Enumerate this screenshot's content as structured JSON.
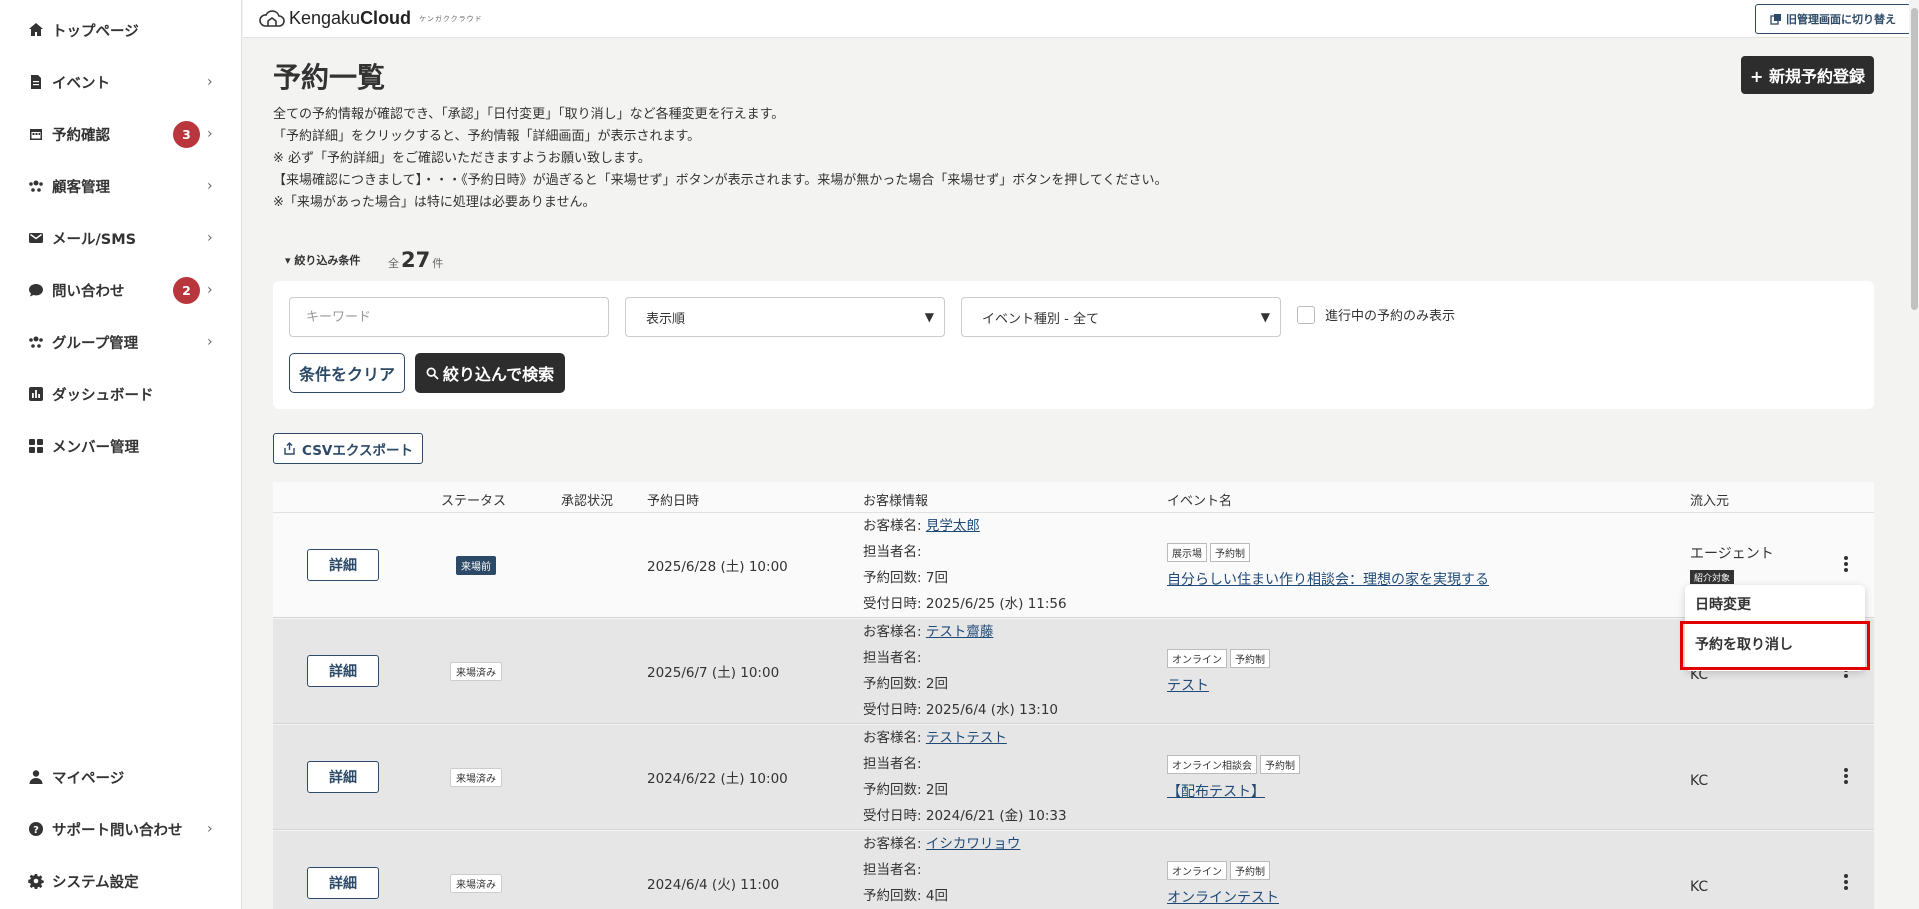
{
  "sidebar": {
    "items": [
      {
        "label": "トップページ",
        "icon": "home-icon"
      },
      {
        "label": "イベント",
        "icon": "document-icon"
      },
      {
        "label": "予約確認",
        "icon": "calendar-icon",
        "badge": "3"
      },
      {
        "label": "顧客管理",
        "icon": "customers-icon"
      },
      {
        "label": "メール/SMS",
        "icon": "mail-icon"
      },
      {
        "label": "問い合わせ",
        "icon": "chat-icon",
        "badge": "2"
      },
      {
        "label": "グループ管理",
        "icon": "group-icon"
      },
      {
        "label": "ダッシュボード",
        "icon": "dashboard-icon"
      },
      {
        "label": "メンバー管理",
        "icon": "members-icon"
      }
    ],
    "bottom_items": [
      {
        "label": "マイページ",
        "icon": "user-icon"
      },
      {
        "label": "サポート問い合わせ",
        "icon": "help-icon"
      },
      {
        "label": "システム設定",
        "icon": "gear-icon"
      }
    ],
    "chevron": "›"
  },
  "header": {
    "logo_brand": "Kengaku",
    "logo_bold": "Cloud",
    "logo_sub": "ケンガククラウド",
    "switch_label": "旧管理画面に切り替え"
  },
  "page": {
    "title": "予約一覧",
    "new_button": "+ 新規予約登録",
    "description": [
      "全ての予約情報が確認でき、「承認」「日付変更」「取り消し」など各種変更を行えます。",
      "「予約詳細」をクリックすると、予約情報「詳細画面」が表示されます。",
      "※ 必ず「予約詳細」をご確認いただきますようお願い致します。",
      "【来場確認につきまして】・・・《予約日時》が過ぎると「来場せず」ボタンが表示されます。来場が無かった場合「来場せず」ボタンを押してください。",
      "※「来場があった場合」は特に処理は必要ありません。"
    ]
  },
  "filter": {
    "toggle_label": "▾ 絞り込み条件",
    "total_prefix": "全",
    "total_count": "27",
    "total_suffix": "件",
    "keyword_placeholder": "キーワード",
    "sort_select": "表示順",
    "event_type_select": "イベント種別 - 全て",
    "in_progress_label": "進行中の予約のみ表示",
    "clear_button": "条件をクリア",
    "search_button": "絞り込んで検索"
  },
  "csv_button": "CSVエクスポート",
  "table": {
    "headers": [
      "ステータス",
      "承認状況",
      "予約日時",
      "お客様情報",
      "イベント名",
      "流入元"
    ],
    "detail_label": "詳細",
    "customer_name_label": "お客様名:",
    "staff_label": "担当者名:",
    "count_label": "予約回数:",
    "received_label": "受付日時:",
    "rows": [
      {
        "status": "来場前",
        "date": "2025/6/28 (土) 10:00",
        "customer": "見学太郎",
        "count": "7回",
        "received": "2025/6/25 (水) 11:56",
        "tags": [
          "展示場",
          "予約制"
        ],
        "event": "自分らしい住まい作り相談会：理想の家を実現する",
        "source": "エージェント",
        "source_badge": "紹介対象"
      },
      {
        "status": "来場済み",
        "date": "2025/6/7 (土) 10:00",
        "customer": "テスト齋藤",
        "count": "2回",
        "received": "2025/6/4 (水) 13:10",
        "tags": [
          "オンライン",
          "予約制"
        ],
        "event": "テスト",
        "source": "KC"
      },
      {
        "status": "来場済み",
        "date": "2024/6/22 (土) 10:00",
        "customer": "テストテスト",
        "count": "2回",
        "received": "2024/6/21 (金) 10:33",
        "tags": [
          "オンライン相談会",
          "予約制"
        ],
        "event": "【配布テスト】",
        "source": "KC"
      },
      {
        "status": "来場済み",
        "date": "2024/6/4 (火) 11:00",
        "customer": "イシカワリョウ",
        "count": "4回",
        "tags": [
          "オンライン",
          "予約制"
        ],
        "event": "オンラインテスト",
        "source": "KC"
      }
    ]
  },
  "dropdown": {
    "change_date": "日時変更",
    "cancel": "予約を取り消し"
  },
  "colors": {
    "accent": "#2c4a67",
    "dark_button": "#2d2d2d",
    "badge": "#b9363d",
    "highlight": "#e10000"
  }
}
